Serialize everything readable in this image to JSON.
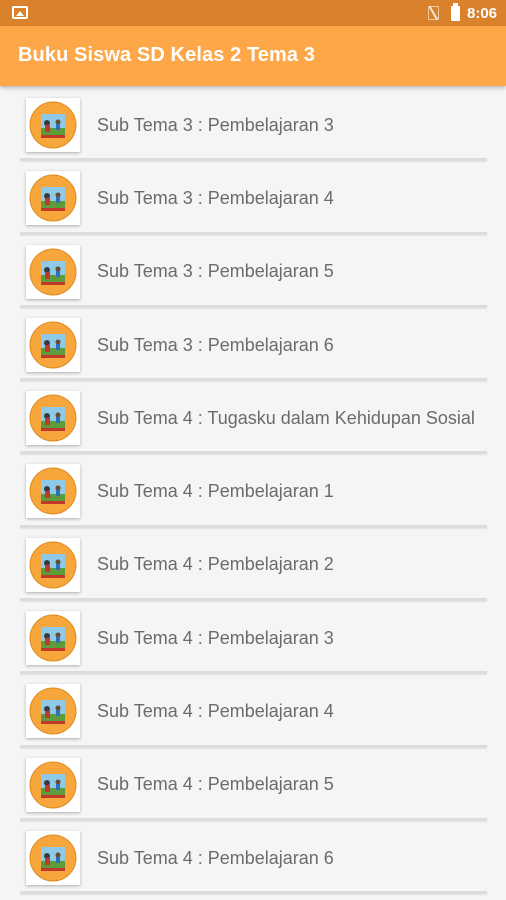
{
  "status_bar": {
    "time": "8:06",
    "icons": [
      "image-notification-icon",
      "no-sim-icon",
      "battery-icon"
    ]
  },
  "app_bar": {
    "title": "Buku Siswa SD Kelas 2 Tema 3"
  },
  "colors": {
    "status_bar": "#d9822b",
    "app_bar": "#fda748",
    "list_text": "#6b6b6b",
    "background": "#f5f5f5"
  },
  "items": [
    {
      "label": "Sub Tema 3 : Pembelajaran 3",
      "icon": "book-cover-icon"
    },
    {
      "label": "Sub Tema 3 : Pembelajaran 4",
      "icon": "book-cover-icon"
    },
    {
      "label": "Sub Tema 3 : Pembelajaran 5",
      "icon": "book-cover-icon"
    },
    {
      "label": "Sub Tema 3 : Pembelajaran 6",
      "icon": "book-cover-icon"
    },
    {
      "label": "Sub Tema 4 : Tugasku dalam Kehidupan Sosial",
      "icon": "book-cover-icon"
    },
    {
      "label": "Sub Tema 4 : Pembelajaran 1",
      "icon": "book-cover-icon"
    },
    {
      "label": "Sub Tema 4 : Pembelajaran 2",
      "icon": "book-cover-icon"
    },
    {
      "label": "Sub Tema 4 : Pembelajaran 3",
      "icon": "book-cover-icon"
    },
    {
      "label": "Sub Tema 4 : Pembelajaran 4",
      "icon": "book-cover-icon"
    },
    {
      "label": "Sub Tema 4 : Pembelajaran 5",
      "icon": "book-cover-icon"
    },
    {
      "label": "Sub Tema 4 : Pembelajaran 6",
      "icon": "book-cover-icon"
    }
  ]
}
